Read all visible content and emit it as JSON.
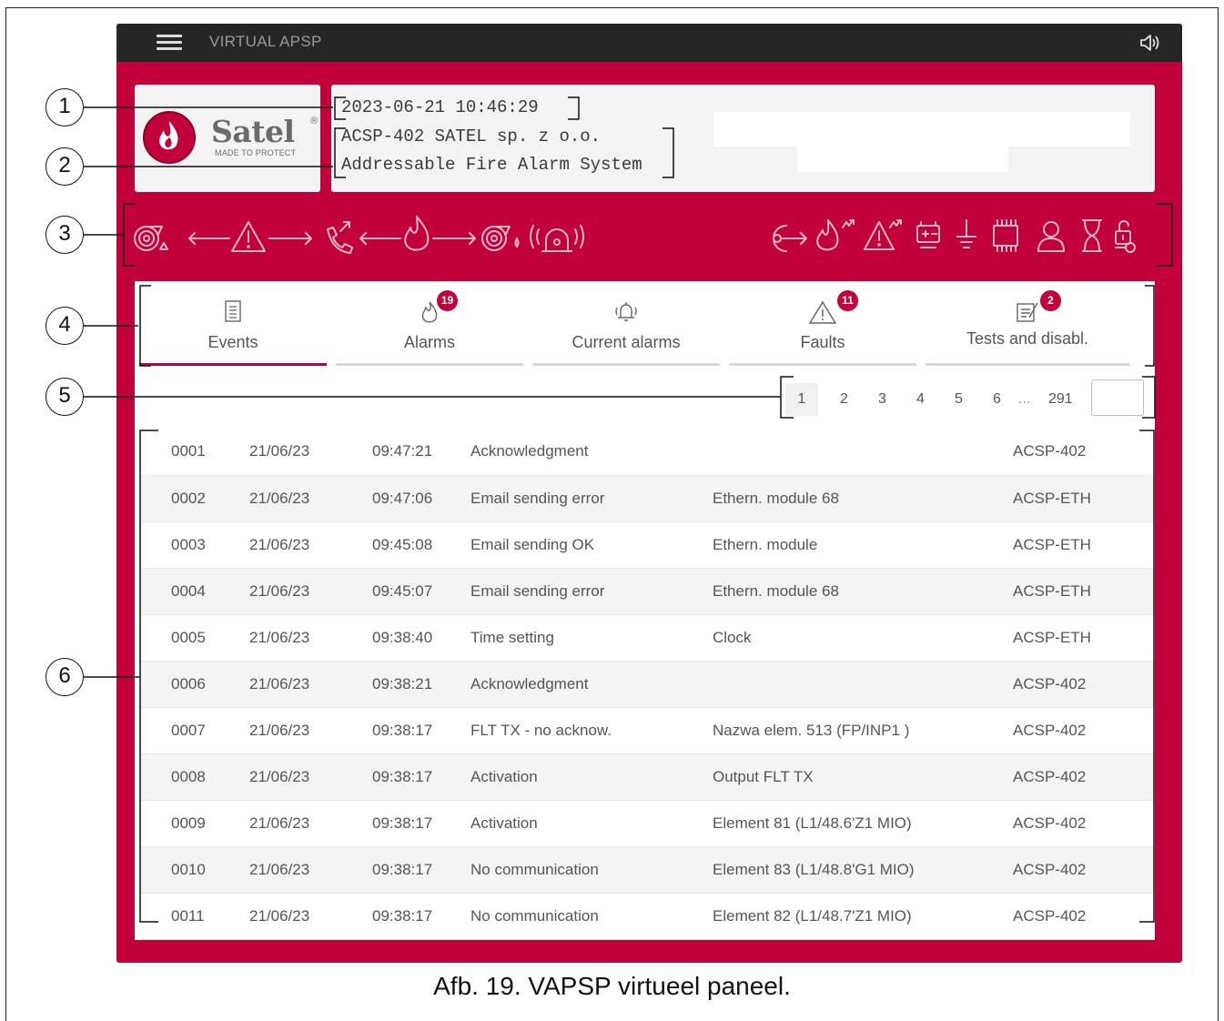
{
  "app": {
    "title": "VIRTUAL APSP"
  },
  "logo": {
    "brand": "Satel",
    "registered": "®",
    "tagline": "MADE TO PROTECT"
  },
  "info": {
    "datetime": "2023-06-21 10:46:29",
    "panel_line1": "ACSP-402 SATEL sp. z o.o.",
    "panel_line2": "Addressable Fire Alarm System"
  },
  "status_icons": [
    "fire-detector-icon",
    "warning-icon",
    "call-icon",
    "fire-icon",
    "fire-detector-icon",
    "siren-icon",
    "output-icon",
    "fire-fault-icon",
    "warning-fault-icon",
    "battery-icon",
    "earth-icon",
    "chip-icon",
    "user-icon",
    "hourglass-icon",
    "unlock-icon"
  ],
  "tabs": [
    {
      "label": "Events",
      "icon": "document-icon",
      "badge": null,
      "active": true
    },
    {
      "label": "Alarms",
      "icon": "fire-icon",
      "badge": "19",
      "active": false
    },
    {
      "label": "Current alarms",
      "icon": "bell-icon",
      "badge": null,
      "active": false
    },
    {
      "label": "Faults",
      "icon": "warning-icon",
      "badge": "11",
      "active": false
    },
    {
      "label": "Tests and disabl.",
      "icon": "clipboard-icon",
      "badge": "2",
      "active": false
    }
  ],
  "pagination": {
    "pages": [
      "1",
      "2",
      "3",
      "4",
      "5",
      "6"
    ],
    "ellipsis": "...",
    "last": "291",
    "current": "1"
  },
  "events": [
    [
      "0001",
      "21/06/23",
      "09:47:21",
      "Acknowledgment",
      "",
      "ACSP-402"
    ],
    [
      "0002",
      "21/06/23",
      "09:47:06",
      "Email sending error",
      "Ethern. module 68",
      "ACSP-ETH"
    ],
    [
      "0003",
      "21/06/23",
      "09:45:08",
      "Email sending OK",
      "Ethern. module",
      "ACSP-ETH"
    ],
    [
      "0004",
      "21/06/23",
      "09:45:07",
      "Email sending error",
      "Ethern. module 68",
      "ACSP-ETH"
    ],
    [
      "0005",
      "21/06/23",
      "09:38:40",
      "Time setting",
      "Clock",
      "ACSP-ETH"
    ],
    [
      "0006",
      "21/06/23",
      "09:38:21",
      "Acknowledgment",
      "",
      "ACSP-402"
    ],
    [
      "0007",
      "21/06/23",
      "09:38:17",
      "FLT TX - no acknow.",
      "Nazwa elem. 513 (FP/INP1 )",
      "ACSP-402"
    ],
    [
      "0008",
      "21/06/23",
      "09:38:17",
      "Activation",
      "Output FLT TX",
      "ACSP-402"
    ],
    [
      "0009",
      "21/06/23",
      "09:38:17",
      "Activation",
      "Element 81 (L1/48.6'Z1 MIO)",
      "ACSP-402"
    ],
    [
      "0010",
      "21/06/23",
      "09:38:17",
      "No communication",
      "Element 83 (L1/48.8'G1 MIO)",
      "ACSP-402"
    ],
    [
      "0011",
      "21/06/23",
      "09:38:17",
      "No communication",
      "Element 82 (L1/48.7'Z1 MIO)",
      "ACSP-402"
    ]
  ],
  "callouts": [
    "1",
    "2",
    "3",
    "4",
    "5",
    "6"
  ],
  "caption": "Afb. 19. VAPSP virtueel paneel.",
  "colors": {
    "brand": "#c2003c",
    "topbar": "#262626",
    "icon_light": "#f2b8c6"
  }
}
